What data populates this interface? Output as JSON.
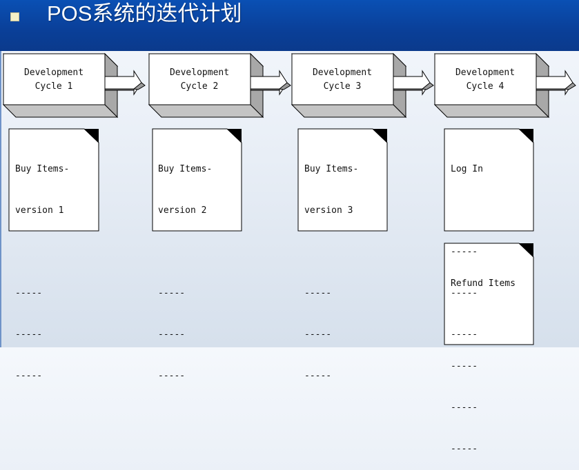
{
  "slide": {
    "title": "POS系统的迭代计划"
  },
  "cycles": [
    {
      "line1": "Development",
      "line2": "Cycle 1"
    },
    {
      "line1": "Development",
      "line2": "Cycle 2"
    },
    {
      "line1": "Development",
      "line2": "Cycle 3"
    },
    {
      "line1": "Development",
      "line2": "Cycle 4"
    }
  ],
  "documents": [
    {
      "lines": [
        "Buy Items-",
        "version 1",
        "",
        "-----",
        "-----",
        "-----"
      ]
    },
    {
      "lines": [
        "Buy Items-",
        "version 2",
        "",
        "-----",
        "-----",
        "-----"
      ]
    },
    {
      "lines": [
        "Buy Items-",
        "version 3",
        "",
        "-----",
        "-----",
        "-----"
      ]
    },
    {
      "lines": [
        "Log In",
        "",
        "-----",
        "-----",
        "-----"
      ]
    },
    {
      "lines": [
        "Refund Items",
        "",
        "-----",
        "-----",
        "-----"
      ]
    }
  ],
  "colors": {
    "title_bar": "#0a3f98",
    "box_front": "#ffffff",
    "box_top": "#d8d8d8",
    "box_side": "#a8a8a8",
    "outline": "#000000"
  }
}
